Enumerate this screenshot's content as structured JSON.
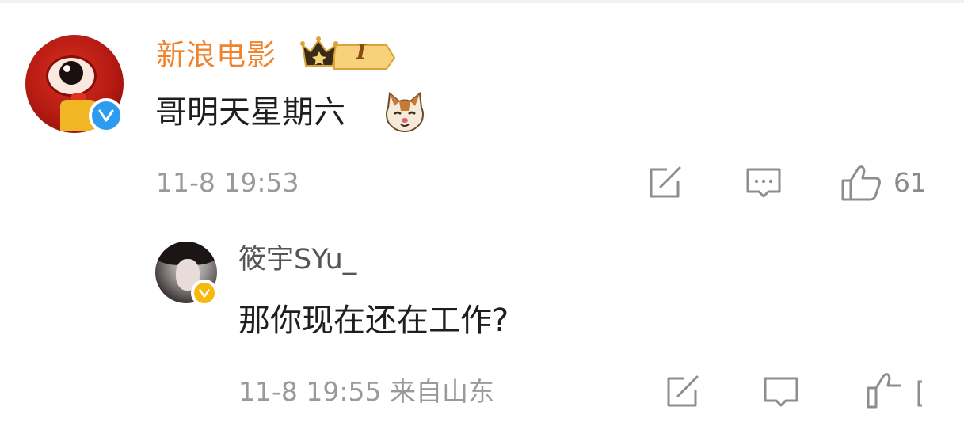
{
  "main_comment": {
    "username": "新浪电影",
    "vip_level": "I",
    "text": "哥明天星期六",
    "emoji": "cat-face-emoji",
    "timestamp": "11-8 19:53",
    "like_count": "61"
  },
  "reply": {
    "username": "筱宇SYu_",
    "text": "那你现在还在工作?",
    "timestamp": "11-8 19:55 来自山东"
  },
  "colors": {
    "username_main": "#f0842e",
    "verified_blue": "#2d9cf0",
    "verified_yellow": "#f5b80c",
    "meta_gray": "#9a9a9a"
  }
}
